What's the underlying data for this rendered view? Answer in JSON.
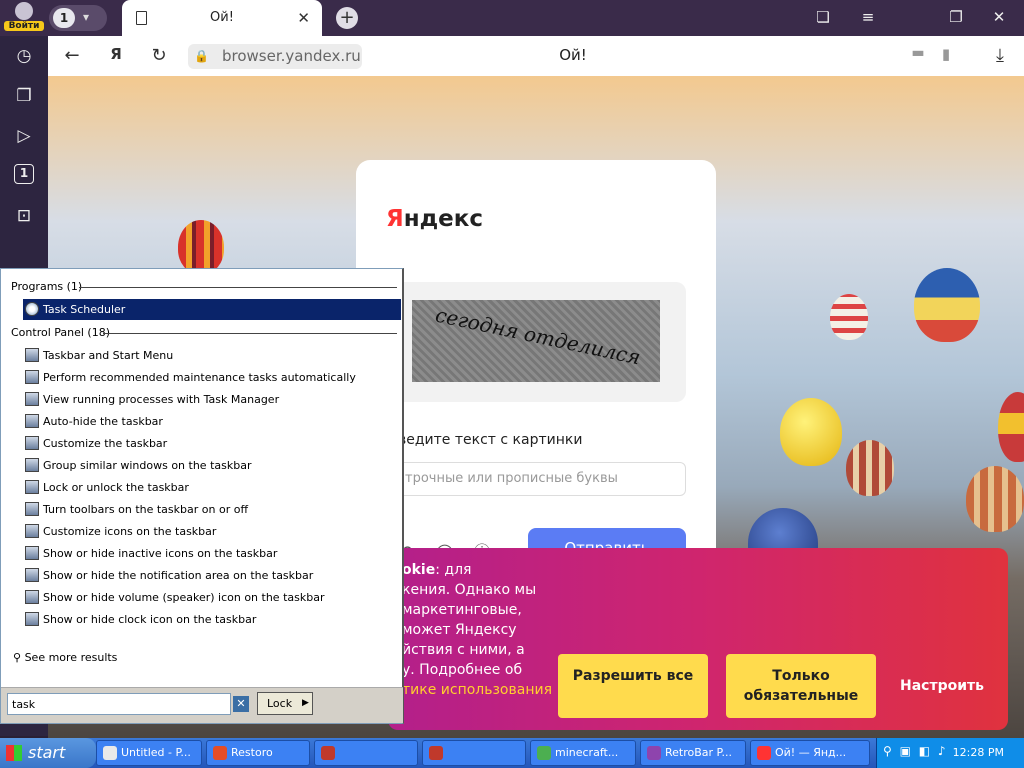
{
  "topbar": {
    "login_label": "Войти",
    "tab_count": "1",
    "active_tab_title": "Ой!",
    "new_tab_icon": "+",
    "bookmarks_icon": "❏",
    "menu_icon": "≡",
    "restore_icon": "❐",
    "close_icon": "✕"
  },
  "addressbar": {
    "back_icon": "←",
    "yandex_icon": "Я",
    "reload_icon": "↻",
    "url": "browser.yandex.ru",
    "page_title": "Ой!",
    "download_icon": "⤓"
  },
  "sidebar": {
    "items": [
      {
        "name": "history",
        "glyph": "◷"
      },
      {
        "name": "collections",
        "glyph": "❐"
      },
      {
        "name": "media",
        "glyph": "▷"
      },
      {
        "name": "tab-badge",
        "glyph": "1"
      },
      {
        "name": "screenshot",
        "glyph": "⊡"
      }
    ]
  },
  "captcha": {
    "logo_y": "Я",
    "logo_rest": "ндекс",
    "word": "сегодня отделился",
    "label": "ведите текст с картинки",
    "input_placeholder": "трочные или прописные буквы",
    "submit_label": "Отправить"
  },
  "cookie": {
    "line1_bold": "okie",
    "line1_rest": ": для",
    "lines": [
      "кения. Однако мы",
      "маркетинговые,",
      "может Яндексу",
      "йствия с ними, а",
      "у. Подробнее об"
    ],
    "link": "тике использования",
    "allow_all": "Разрешить все",
    "required_only": "Только обязательные",
    "configure": "Настроить"
  },
  "startmenu": {
    "programs_header": "Programs (1)",
    "programs": [
      "Task Scheduler"
    ],
    "control_header": "Control Panel (18)",
    "control_items": [
      "Taskbar and Start Menu",
      "Perform recommended maintenance tasks automatically",
      "View running processes with Task Manager",
      "Auto-hide the taskbar",
      "Customize the taskbar",
      "Group similar windows on the taskbar",
      "Lock or unlock the taskbar",
      "Turn toolbars on the taskbar on or off",
      "Customize icons on the taskbar",
      "Show or hide inactive icons on the taskbar",
      "Show or hide the notification area on the taskbar",
      "Show or hide volume (speaker) icon on the taskbar",
      "Show or hide clock icon on the taskbar"
    ],
    "see_more": "See more results",
    "search_value": "task",
    "lock_label": "Lock"
  },
  "taskbar": {
    "start_label": "start",
    "tasks": [
      {
        "label": "Untitled - P...",
        "color": "#e9e9e9"
      },
      {
        "label": "Restoro",
        "color": "#e44d26"
      },
      {
        "label": "",
        "color": "#c0392b"
      },
      {
        "label": "",
        "color": "#c0392b"
      },
      {
        "label": "minecraft...",
        "color": "#4caf50"
      },
      {
        "label": "RetroBar P...",
        "color": "#8e44ad"
      },
      {
        "label": "Ой! — Янд...",
        "color": "#ff3333"
      }
    ],
    "tray_icons": "⚲ ▣ ◧ ♪",
    "clock": "12:28 PM"
  }
}
